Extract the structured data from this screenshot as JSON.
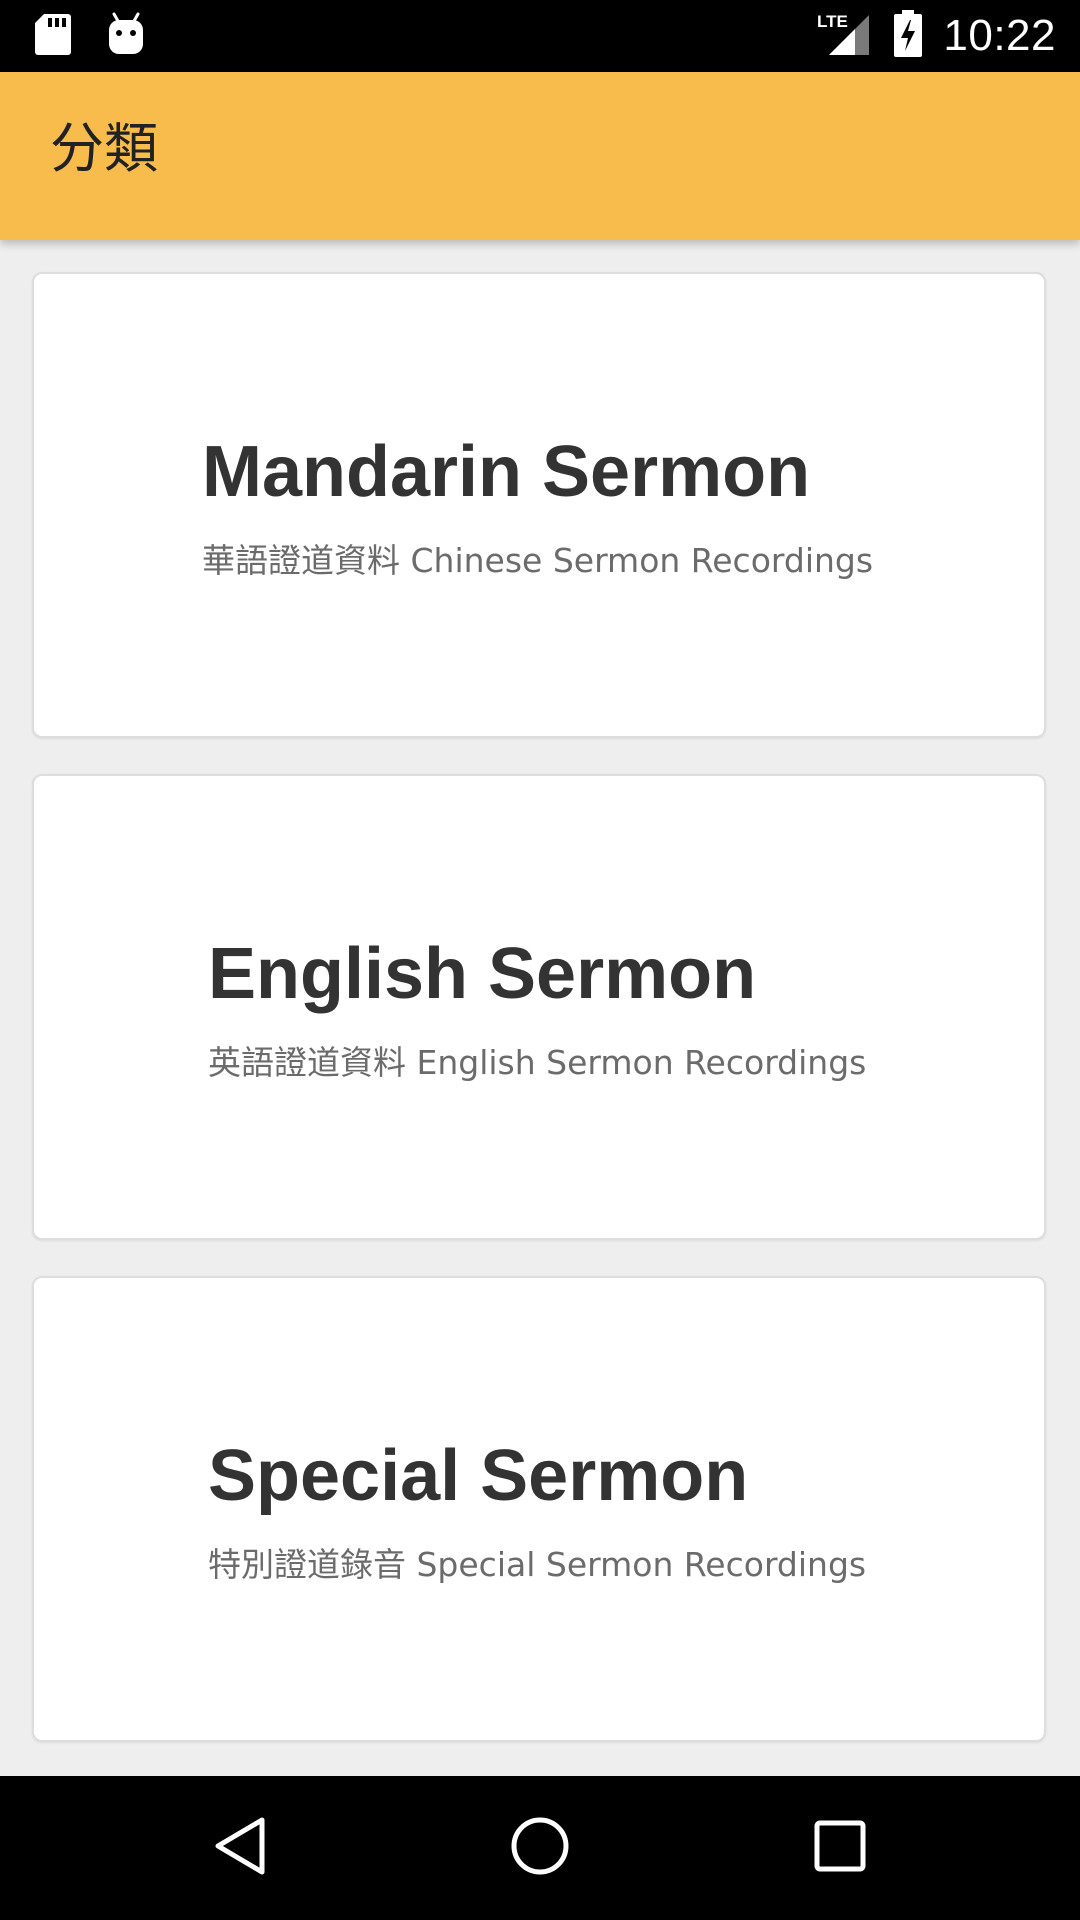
{
  "status_bar": {
    "time": "10:22",
    "network": "LTE",
    "icons": [
      "sd-card-icon",
      "android-icon",
      "lte-signal-icon",
      "battery-charging-icon"
    ]
  },
  "app_bar": {
    "title": "分類",
    "color": "#F8BC4C"
  },
  "cards": [
    {
      "title": "Mandarin Sermon",
      "subtitle": "華語證道資料 Chinese Sermon Recordings"
    },
    {
      "title": "English Sermon",
      "subtitle": "英語證道資料 English Sermon Recordings"
    },
    {
      "title": "Special Sermon",
      "subtitle": "特別證道錄音 Special Sermon Recordings"
    }
  ],
  "nav_bar": {
    "icons": [
      "back-icon",
      "home-icon",
      "recents-icon"
    ]
  }
}
